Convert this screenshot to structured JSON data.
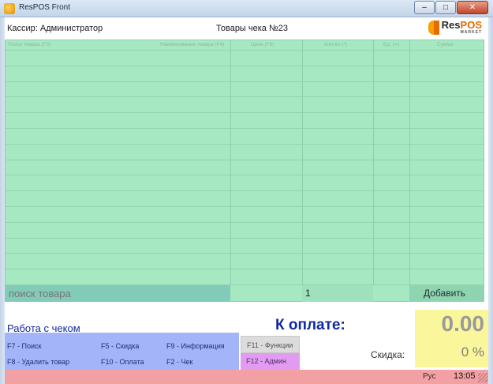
{
  "window": {
    "title": "ResPOS Front",
    "controls": {
      "minimize": "–",
      "maximize": "□",
      "close": "✕"
    }
  },
  "header": {
    "cashier": "Кассир: Администратор",
    "receipt_title": "Товары чека №23",
    "logo": {
      "brand_main": "Res",
      "brand_accent": "POS",
      "sub": "MARKET"
    }
  },
  "table": {
    "columns": [
      "Поиск товара (F3)",
      "Наименование товара (F4)",
      "Цена (F6)",
      "Кол-во (*)",
      "Ед. (=)",
      "Сумма"
    ],
    "rows": []
  },
  "entry": {
    "search_placeholder": "поиск товара",
    "quantity": "1",
    "add_label": "Добавить"
  },
  "receipt_work": {
    "label": "Работа с чеком",
    "hotkeys": [
      "F7 - Поиск",
      "F5  - Скидка",
      "F9 - Информация",
      "F8 - Удалить товар",
      "F10 - Оплата",
      "F2 - Чек"
    ]
  },
  "side_buttons": {
    "functions": "F11 - Функции",
    "admin": "F12 - Админ"
  },
  "payment": {
    "label": "К оплате:",
    "total": "0.00",
    "discount_label": "Скидка:",
    "discount_value": "0 %"
  },
  "status": {
    "language": "Рус",
    "time": "13:05"
  },
  "colors": {
    "grid": "#a6e8c2",
    "hotkey_panel": "#a3b4f8",
    "admin": "#e19cf2",
    "total_box": "#f9f69b",
    "status_bar": "#f2a0a3",
    "accent_text": "#102a9e"
  }
}
